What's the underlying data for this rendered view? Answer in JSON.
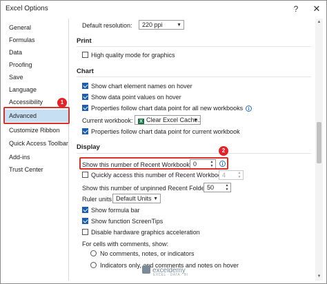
{
  "window": {
    "title": "Excel Options",
    "help_glyph": "?",
    "close_glyph": "✕"
  },
  "sidebar": {
    "items": [
      {
        "label": "General"
      },
      {
        "label": "Formulas"
      },
      {
        "label": "Data"
      },
      {
        "label": "Proofing"
      },
      {
        "label": "Save"
      },
      {
        "label": "Language"
      },
      {
        "label": "Accessibility"
      },
      {
        "label": "Advanced",
        "selected": true
      },
      {
        "label": "Customize Ribbon"
      },
      {
        "label": "Quick Access Toolbar"
      },
      {
        "label": "Add-ins"
      },
      {
        "label": "Trust Center"
      }
    ]
  },
  "annotations": {
    "badge_1": "1",
    "badge_2": "2",
    "highlight_color": "#d9302c"
  },
  "content": {
    "default_resolution_label": "Default resolution:",
    "default_resolution_value": "220 ppi",
    "print": {
      "title": "Print",
      "high_quality": {
        "label": "High quality mode for graphics",
        "checked": false
      }
    },
    "chart": {
      "title": "Chart",
      "show_element_names": {
        "label": "Show chart element names on hover",
        "checked": true
      },
      "show_point_values": {
        "label": "Show data point values on hover",
        "checked": true
      },
      "properties_all": {
        "label": "Properties follow chart data point for all new workbooks",
        "checked": true
      },
      "current_workbook_label": "Current workbook:",
      "current_workbook_value": "Clear Excel Cache.x...",
      "properties_current": {
        "label": "Properties follow chart data point for current workbook",
        "checked": true
      }
    },
    "display": {
      "title": "Display",
      "recent_workbooks_label": "Show this number of Recent Workbooks:",
      "recent_workbooks_value": "0",
      "quick_access_label": "Quickly access this number of Recent Workbooks:",
      "quick_access_value": "4",
      "unpinned_folders_label": "Show this number of unpinned Recent Folders:",
      "unpinned_folders_value": "50",
      "ruler_units_label": "Ruler units",
      "ruler_units_value": "Default Units",
      "show_formula_bar": {
        "label": "Show formula bar",
        "checked": true
      },
      "show_screentips": {
        "label": "Show function ScreenTips",
        "checked": true
      },
      "disable_hw_accel": {
        "label": "Disable hardware graphics acceleration",
        "checked": false
      },
      "comments_label": "For cells with comments, show:",
      "no_comments": "No comments, notes, or indicators",
      "indicators_only": "Indicators only, and comments and notes on hover"
    }
  },
  "watermark": {
    "brand": "exceldemy",
    "tagline": "EXCEL · DATA · BI"
  },
  "icons": {
    "info": "info-icon",
    "excel": "excel-file-icon",
    "scroll_up": "scroll-up-icon",
    "scroll_down": "scroll-down-icon"
  }
}
